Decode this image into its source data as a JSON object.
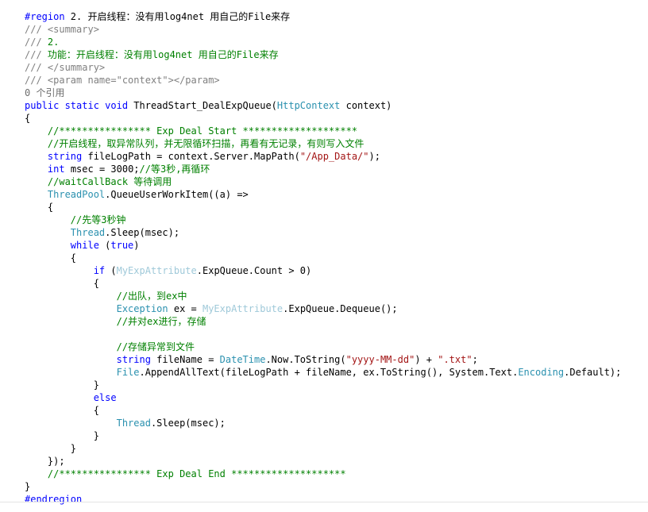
{
  "colors": {
    "keyword": "#0000FF",
    "comment": "#008000",
    "doc_tag": "#808080",
    "type": "#2B91AF",
    "string": "#A31515",
    "plain": "#000000",
    "attribute_type": "#9FC9D9",
    "codelens": "#6E6E6E"
  },
  "code_lines": [
    [
      {
        "t": "#region",
        "c": "keyword"
      },
      {
        "t": " 2. 开启线程：没有用log4net 用自己的File来存",
        "c": "plain"
      }
    ],
    [
      {
        "t": "/// <summary>",
        "c": "doc_tag"
      }
    ],
    [
      {
        "t": "/// ",
        "c": "doc_tag"
      },
      {
        "t": "2.",
        "c": "comment"
      }
    ],
    [
      {
        "t": "/// ",
        "c": "doc_tag"
      },
      {
        "t": "功能：开启线程：没有用log4net 用自己的File来存",
        "c": "comment"
      }
    ],
    [
      {
        "t": "/// </summary>",
        "c": "doc_tag"
      }
    ],
    [
      {
        "t": "/// <param name=\"context\"></param>",
        "c": "doc_tag"
      }
    ],
    [
      {
        "t": "0 个引用",
        "c": "codelens"
      }
    ],
    [
      {
        "t": "public static void",
        "c": "keyword"
      },
      {
        "t": " ThreadStart_DealExpQueue(",
        "c": "plain"
      },
      {
        "t": "HttpContext",
        "c": "type"
      },
      {
        "t": " context)",
        "c": "plain"
      }
    ],
    [
      {
        "t": "{",
        "c": "plain"
      }
    ],
    [
      {
        "t": "    ",
        "c": "plain"
      },
      {
        "t": "//**************** Exp Deal Start ********************",
        "c": "comment"
      }
    ],
    [
      {
        "t": "    ",
        "c": "plain"
      },
      {
        "t": "//开启线程，取异常队列，并无限循环扫描，再看有无记录，有则写入文件",
        "c": "comment"
      }
    ],
    [
      {
        "t": "    ",
        "c": "plain"
      },
      {
        "t": "string",
        "c": "keyword"
      },
      {
        "t": " fileLogPath = context.Server.MapPath(",
        "c": "plain"
      },
      {
        "t": "\"/App_Data/\"",
        "c": "string"
      },
      {
        "t": ");",
        "c": "plain"
      }
    ],
    [
      {
        "t": "    ",
        "c": "plain"
      },
      {
        "t": "int",
        "c": "keyword"
      },
      {
        "t": " msec = 3000;",
        "c": "plain"
      },
      {
        "t": "//等3秒,再循环",
        "c": "comment"
      }
    ],
    [
      {
        "t": "    ",
        "c": "plain"
      },
      {
        "t": "//waitCallBack 等待调用",
        "c": "comment"
      }
    ],
    [
      {
        "t": "    ",
        "c": "plain"
      },
      {
        "t": "ThreadPool",
        "c": "type"
      },
      {
        "t": ".QueueUserWorkItem((a) =>",
        "c": "plain"
      }
    ],
    [
      {
        "t": "    {",
        "c": "plain"
      }
    ],
    [
      {
        "t": "        ",
        "c": "plain"
      },
      {
        "t": "//先等3秒钟",
        "c": "comment"
      }
    ],
    [
      {
        "t": "        ",
        "c": "plain"
      },
      {
        "t": "Thread",
        "c": "type"
      },
      {
        "t": ".Sleep(msec);",
        "c": "plain"
      }
    ],
    [
      {
        "t": "        ",
        "c": "plain"
      },
      {
        "t": "while",
        "c": "keyword"
      },
      {
        "t": " (",
        "c": "plain"
      },
      {
        "t": "true",
        "c": "keyword"
      },
      {
        "t": ")",
        "c": "plain"
      }
    ],
    [
      {
        "t": "        {",
        "c": "plain"
      }
    ],
    [
      {
        "t": "            ",
        "c": "plain"
      },
      {
        "t": "if",
        "c": "keyword"
      },
      {
        "t": " (",
        "c": "plain"
      },
      {
        "t": "MyExpAttribute",
        "c": "attribute_type"
      },
      {
        "t": ".ExpQueue.Count > 0)",
        "c": "plain"
      }
    ],
    [
      {
        "t": "            {",
        "c": "plain"
      }
    ],
    [
      {
        "t": "                ",
        "c": "plain"
      },
      {
        "t": "//出队，到ex中",
        "c": "comment"
      }
    ],
    [
      {
        "t": "                ",
        "c": "plain"
      },
      {
        "t": "Exception",
        "c": "type"
      },
      {
        "t": " ex = ",
        "c": "plain"
      },
      {
        "t": "MyExpAttribute",
        "c": "attribute_type"
      },
      {
        "t": ".ExpQueue.Dequeue();",
        "c": "plain"
      }
    ],
    [
      {
        "t": "                ",
        "c": "plain"
      },
      {
        "t": "//并对ex进行，存储",
        "c": "comment"
      }
    ],
    [],
    [
      {
        "t": "                ",
        "c": "plain"
      },
      {
        "t": "//存储异常到文件",
        "c": "comment"
      }
    ],
    [
      {
        "t": "                ",
        "c": "plain"
      },
      {
        "t": "string",
        "c": "keyword"
      },
      {
        "t": " fileName = ",
        "c": "plain"
      },
      {
        "t": "DateTime",
        "c": "type"
      },
      {
        "t": ".Now.ToString(",
        "c": "plain"
      },
      {
        "t": "\"yyyy-MM-dd\"",
        "c": "string"
      },
      {
        "t": ") + ",
        "c": "plain"
      },
      {
        "t": "\".txt\"",
        "c": "string"
      },
      {
        "t": ";",
        "c": "plain"
      }
    ],
    [
      {
        "t": "                ",
        "c": "plain"
      },
      {
        "t": "File",
        "c": "type"
      },
      {
        "t": ".AppendAllText(fileLogPath + fileName, ex.ToString(), System.Text.",
        "c": "plain"
      },
      {
        "t": "Encoding",
        "c": "type"
      },
      {
        "t": ".Default);",
        "c": "plain"
      }
    ],
    [
      {
        "t": "            }",
        "c": "plain"
      }
    ],
    [
      {
        "t": "            ",
        "c": "plain"
      },
      {
        "t": "else",
        "c": "keyword"
      }
    ],
    [
      {
        "t": "            {",
        "c": "plain"
      }
    ],
    [
      {
        "t": "                ",
        "c": "plain"
      },
      {
        "t": "Thread",
        "c": "type"
      },
      {
        "t": ".Sleep(msec);",
        "c": "plain"
      }
    ],
    [
      {
        "t": "            }",
        "c": "plain"
      }
    ],
    [
      {
        "t": "        }",
        "c": "plain"
      }
    ],
    [
      {
        "t": "    });",
        "c": "plain"
      }
    ],
    [
      {
        "t": "    ",
        "c": "plain"
      },
      {
        "t": "//**************** Exp Deal End ********************",
        "c": "comment"
      }
    ],
    [
      {
        "t": "}",
        "c": "plain"
      }
    ],
    [
      {
        "t": "#endregion",
        "c": "keyword"
      }
    ]
  ]
}
